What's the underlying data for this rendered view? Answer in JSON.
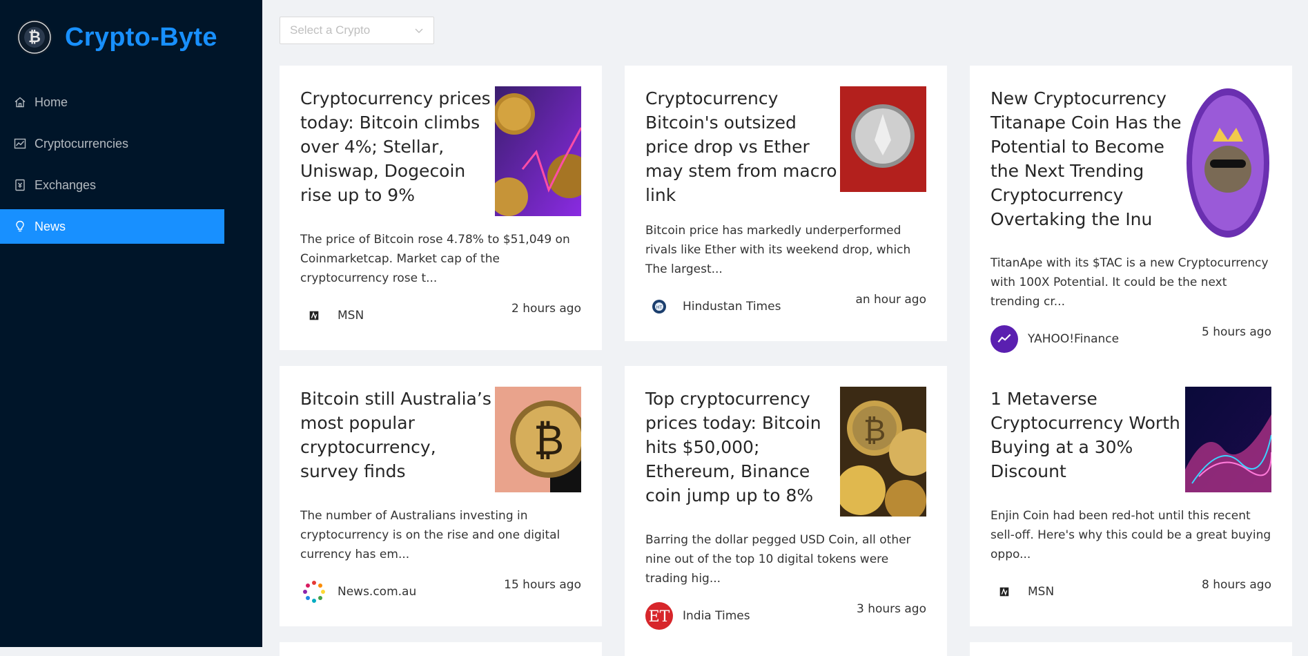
{
  "brand": {
    "title": "Crypto-Byte",
    "logo_icon": "bitcoin-coin-icon"
  },
  "menu": [
    {
      "label": "Home",
      "icon": "home-icon",
      "active": false
    },
    {
      "label": "Cryptocurrencies",
      "icon": "line-chart-icon",
      "active": false
    },
    {
      "label": "Exchanges",
      "icon": "money-collect-icon",
      "active": false
    },
    {
      "label": "News",
      "icon": "bulb-icon",
      "active": true
    }
  ],
  "select": {
    "placeholder": "Select a Crypto"
  },
  "colors": {
    "sidebar_bg": "#001529",
    "accent": "#1890ff",
    "page_bg": "#f0f2f5"
  },
  "news": [
    {
      "title": "Cryptocurrency prices today: Bitcoin climbs over 4%; Stellar, Uniswap, Dogecoin rise up to 9%",
      "description": "The price of Bitcoin rose 4.78% to $51,049 on Coinmarketcap. Market cap of the cryptocurrency rose t...",
      "provider": "MSN",
      "time": "2 hours ago"
    },
    {
      "title": "Cryptocurrency Bitcoin's outsized price drop vs Ether may stem from macro link",
      "description": "Bitcoin price has markedly underperformed rivals like Ether with its weekend drop, which The largest...",
      "provider": "Hindustan Times",
      "time": "an hour ago"
    },
    {
      "title": "New Cryptocurrency Titanape Coin Has the Potential to Become the Next Trending Cryptocurrency Overtaking the Inu",
      "description": "TitanApe with its $TAC is a new Cryptocurrency with 100X Potential. It could be the next trending cr...",
      "provider": "YAHOO!Finance",
      "time": "5 hours ago"
    },
    {
      "title": "Bitcoin still Australia’s most popular cryptocurrency, survey finds",
      "description": "The number of Australians investing in cryptocurrency is on the rise and one digital currency has em...",
      "provider": "News.com.au",
      "time": "15 hours ago"
    },
    {
      "title": "Top cryptocurrency prices today: Bitcoin hits $50,000; Ethereum, Binance coin jump up to 8%",
      "description": "Barring the dollar pegged USD Coin, all other nine out of the top 10 digital tokens were trading hig...",
      "provider": "India Times",
      "time": "3 hours ago"
    },
    {
      "title": "1 Metaverse Cryptocurrency Worth Buying at a 30% Discount",
      "description": "Enjin Coin had been red-hot until this recent sell-off. Here's why this could be a great buying oppo...",
      "provider": "MSN",
      "time": "8 hours ago"
    }
  ]
}
